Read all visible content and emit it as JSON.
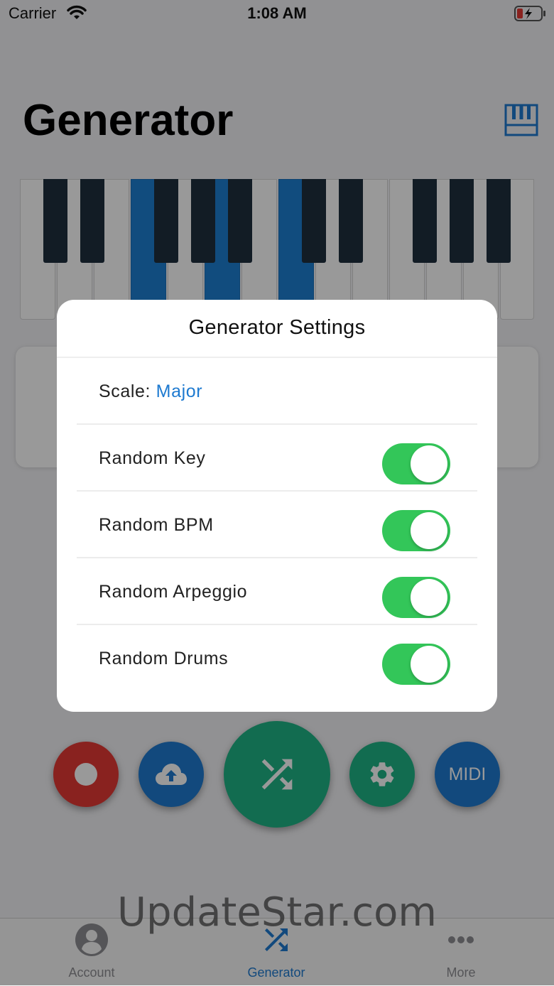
{
  "status_bar": {
    "carrier": "Carrier",
    "time": "1:08 AM"
  },
  "header": {
    "title": "Generator",
    "piano_icon": "piano-keys-icon"
  },
  "piano": {
    "highlight_color": "#1d7fd3",
    "highlighted_white_keys": [
      3,
      5,
      7
    ]
  },
  "actions": [
    {
      "name": "record",
      "icon": "record-icon",
      "color": "#e53935"
    },
    {
      "name": "upload",
      "icon": "cloud-upload-icon",
      "color": "#1e7ad0"
    },
    {
      "name": "generate",
      "icon": "shuffle-icon",
      "color": "#1fb585"
    },
    {
      "name": "settings",
      "icon": "gear-icon",
      "color": "#1fb585"
    },
    {
      "name": "midi",
      "label": "MIDI",
      "color": "#1e7ad0"
    }
  ],
  "tabs": [
    {
      "label": "Account",
      "icon": "account-icon",
      "active": false
    },
    {
      "label": "Generator",
      "icon": "shuffle-icon",
      "active": true
    },
    {
      "label": "More",
      "icon": "more-icon",
      "active": false
    }
  ],
  "watermark": "UpdateStar.com",
  "dialog": {
    "title": "Generator Settings",
    "scale_label": "Scale:",
    "scale_value": "Major",
    "toggles": [
      {
        "label": "Random Key",
        "on": true
      },
      {
        "label": "Random BPM",
        "on": true
      },
      {
        "label": "Random Arpeggio",
        "on": true
      },
      {
        "label": "Random Drums",
        "on": true
      }
    ],
    "toggle_on_color": "#33c659"
  }
}
